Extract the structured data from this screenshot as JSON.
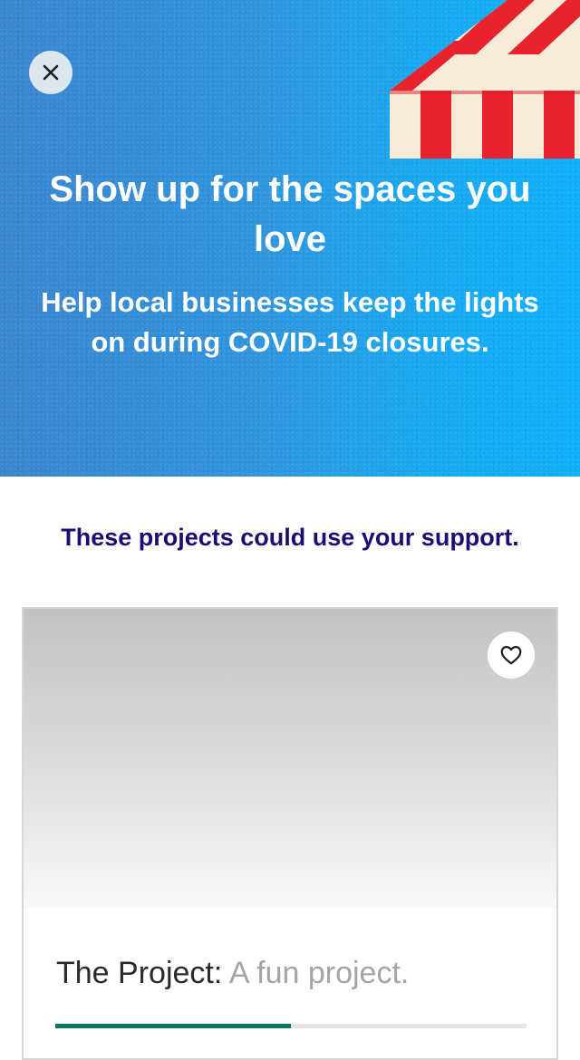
{
  "hero": {
    "title": "Show up for the spaces you love",
    "subtitle": "Help local businesses keep the lights on during COVID-19 closures.",
    "close_icon": "close-icon",
    "colors": {
      "gradient_start": "#3a86cf",
      "gradient_end": "#0fb0fb",
      "awning_red": "#e8232e",
      "awning_cream": "#f8ecd8"
    }
  },
  "section": {
    "heading": "These projects could use your support."
  },
  "project_card": {
    "name": "The Project:",
    "description": "A fun project.",
    "favorite_icon": "heart-outline-icon",
    "progress_fraction": 0.5,
    "colors": {
      "heading": "#1b0d74",
      "progress": "#05765f"
    }
  }
}
